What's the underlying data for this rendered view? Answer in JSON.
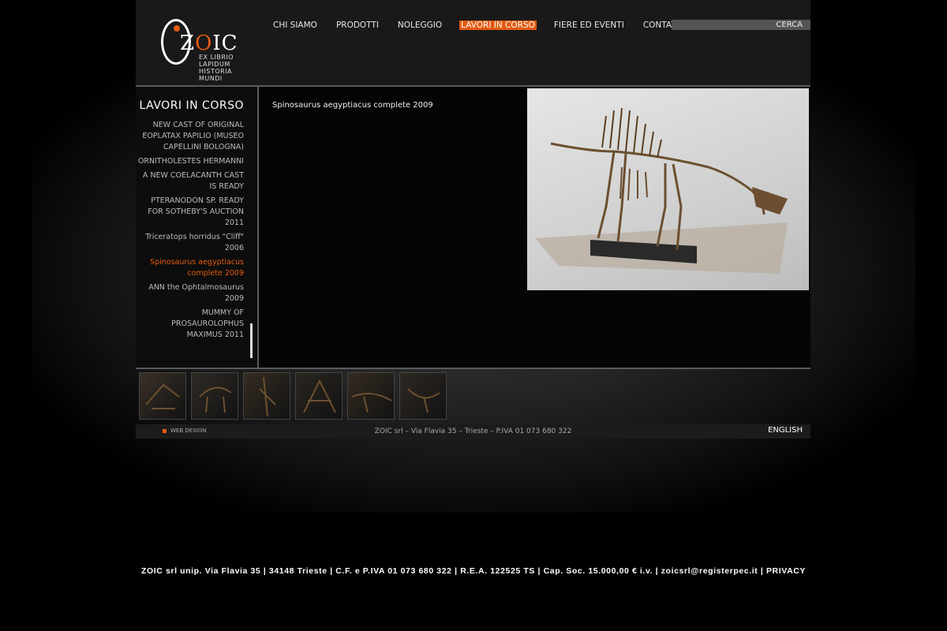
{
  "logo": {
    "text_pre": "Z",
    "text_o": "O",
    "text_post": "IC",
    "tagline_1": "EX LIBRIO LAPIDUM",
    "tagline_2": "HISTORIA MUNDI"
  },
  "nav": {
    "items": [
      {
        "label": "CHI SIAMO"
      },
      {
        "label": "PRODOTTI"
      },
      {
        "label": "NOLEGGIO"
      },
      {
        "label": "LAVORI IN CORSO"
      },
      {
        "label": "FIERE ED EVENTI"
      },
      {
        "label": "CONTATTI"
      }
    ],
    "active_index": 3
  },
  "search": {
    "label": "CERCA"
  },
  "sidebar": {
    "title": "LAVORI IN CORSO",
    "items": [
      {
        "label": "NEW CAST OF ORIGINAL EOPLATAX PAPILIO (MUSEO CAPELLINI BOLOGNA)"
      },
      {
        "label": "ORNITHOLESTES HERMANNI"
      },
      {
        "label": "A NEW COELACANTH CAST IS READY"
      },
      {
        "label": "PTERANODON SP. READY FOR SOTHEBY'S AUCTION 2011"
      },
      {
        "label": "Triceratops horridus \"Cliff\" 2006"
      },
      {
        "label": "Spinosaurus aegyptiacus complete 2009"
      },
      {
        "label": "ANN the Ophtalmosaurus 2009"
      },
      {
        "label": "MUMMY OF PROSAUROLOPHUS MAXIMUS 2011"
      }
    ],
    "active_index": 5
  },
  "main": {
    "caption": "Spinosaurus aegyptiacus complete 2009"
  },
  "thumbs": {
    "count": 6
  },
  "footer": {
    "webdesign": "WEB DESIGN",
    "company": "ZOIC srl  –  Via Flavia 35  –  Trieste  –  P.IVA 01 073 680 322",
    "language": "ENGLISH"
  },
  "legal": {
    "text": "ZOIC srl unip. Via Flavia 35 | 34148 Trieste | C.F. e P.IVA 01 073 680 322 | R.E.A. 122525 TS | Cap. Soc. 15.000,00 € i.v. | zoicsrl@registerpec.it |",
    "privacy": "PRIVACY"
  },
  "colors": {
    "accent": "#e35b10",
    "background": "#000000"
  }
}
